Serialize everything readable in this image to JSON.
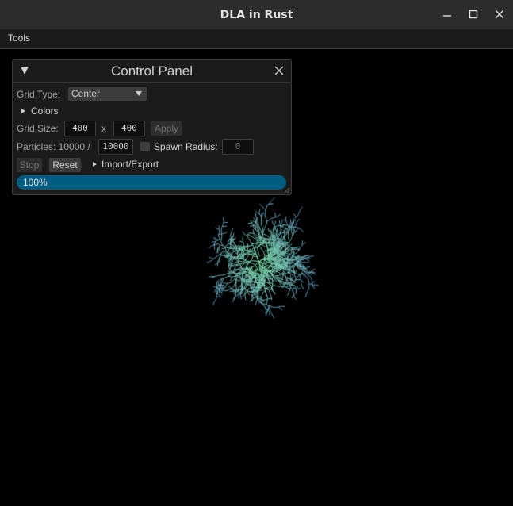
{
  "window": {
    "title": "DLA in Rust"
  },
  "menu": {
    "tools": "Tools"
  },
  "panel": {
    "title": "Control Panel",
    "grid_type_label": "Grid Type:",
    "grid_type_value": "Center",
    "colors_label": "Colors",
    "grid_size_label": "Grid Size:",
    "grid_width": "400",
    "grid_x": "x",
    "grid_height": "400",
    "apply_label": "Apply",
    "particles_label": "Particles: 10000 /",
    "particles_max": "10000",
    "spawn_radius_label": "Spawn Radius:",
    "spawn_radius_value": "0",
    "stop_label": "Stop",
    "reset_label": "Reset",
    "import_export_label": "Import/Export",
    "progress_text": "100%",
    "progress": 1.0
  },
  "colors": {
    "titlebar": "#2c2c2c",
    "panel_bg": "#1b1b1b",
    "progress": "#005c80",
    "cluster_inner": "#7fe0a8",
    "cluster_outer": "#3a3ec8"
  }
}
